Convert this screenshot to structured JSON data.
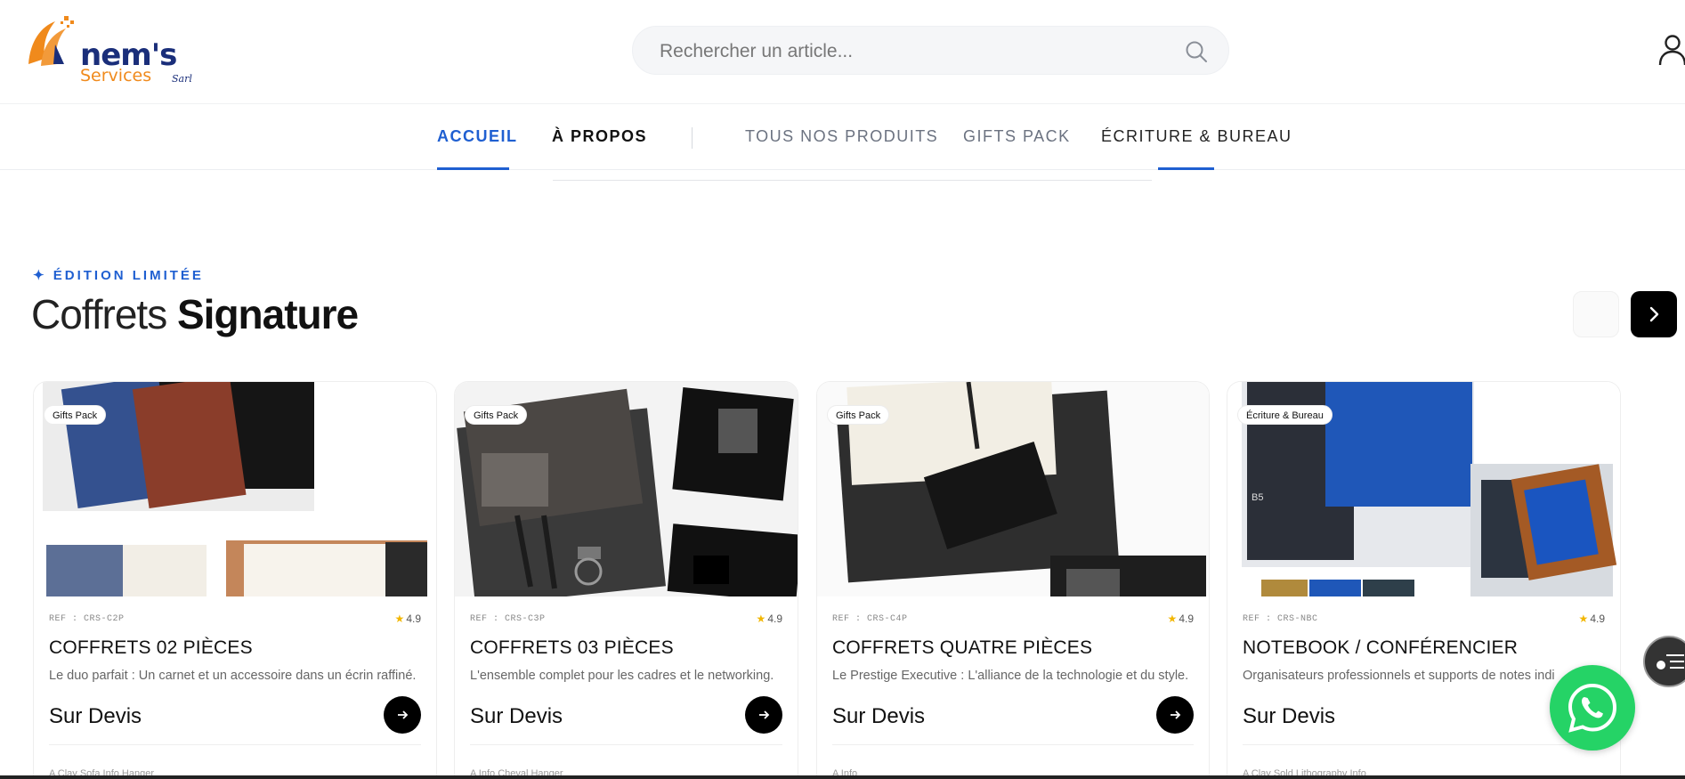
{
  "header": {
    "logo_name": "nem's",
    "logo_sub": "Services",
    "logo_suffix": "Sarl",
    "search_placeholder": "Rechercher un article..."
  },
  "nav": {
    "items": [
      {
        "label": "ACCUEIL"
      },
      {
        "label": "À PROPOS"
      },
      {
        "label": "TOUS NOS PRODUITS"
      },
      {
        "label": "GIFTS PACK"
      },
      {
        "label": "ÉCRITURE & BUREAU"
      }
    ]
  },
  "section": {
    "eyebrow": "✦ ÉDITION LIMITÉE",
    "title_light": "Coffrets ",
    "title_bold": "Signature"
  },
  "products": [
    {
      "badge": "Gifts Pack",
      "ref": "REF : CRS-C2P",
      "rating": "4.9",
      "title": "COFFRETS 02 PIÈCES",
      "desc": "Le duo parfait : Un carnet et un accessoire dans un écrin raffiné.",
      "price": "Sur Devis",
      "foot": "A Clay Sofa Info Hanger"
    },
    {
      "badge": "Gifts Pack",
      "ref": "REF : CRS-C3P",
      "rating": "4.9",
      "title": "COFFRETS 03 PIÈCES",
      "desc": "L'ensemble complet pour les cadres et le networking.",
      "price": "Sur Devis",
      "foot": "A Info Cheval Hanger"
    },
    {
      "badge": "Gifts Pack",
      "ref": "REF : CRS-C4P",
      "rating": "4.9",
      "title": "COFFRETS QUATRE PIÈCES",
      "desc": "Le Prestige Executive : L'alliance de la technologie et du style.",
      "price": "Sur Devis",
      "foot": "A Info"
    },
    {
      "badge": "Écriture & Bureau",
      "ref": "REF : CRS-NBC",
      "rating": "4.9",
      "title": "NOTEBOOK / CONFÉRENCIER",
      "desc": "Organisateurs professionnels et supports de notes indi",
      "price": "Sur Devis",
      "foot": "A Clay Sold Lithography Info"
    }
  ],
  "colors": {
    "accent": "#1f5fd1",
    "brand_navy": "#1a2e7a",
    "brand_orange": "#f08a1c",
    "whatsapp": "#25d366",
    "star": "#f2b600"
  },
  "icons": {
    "search": "search-icon",
    "user": "user-icon",
    "next": "chevron-right-icon",
    "arrow": "arrow-right-icon",
    "toc": "list-icon",
    "whatsapp": "whatsapp-icon"
  }
}
